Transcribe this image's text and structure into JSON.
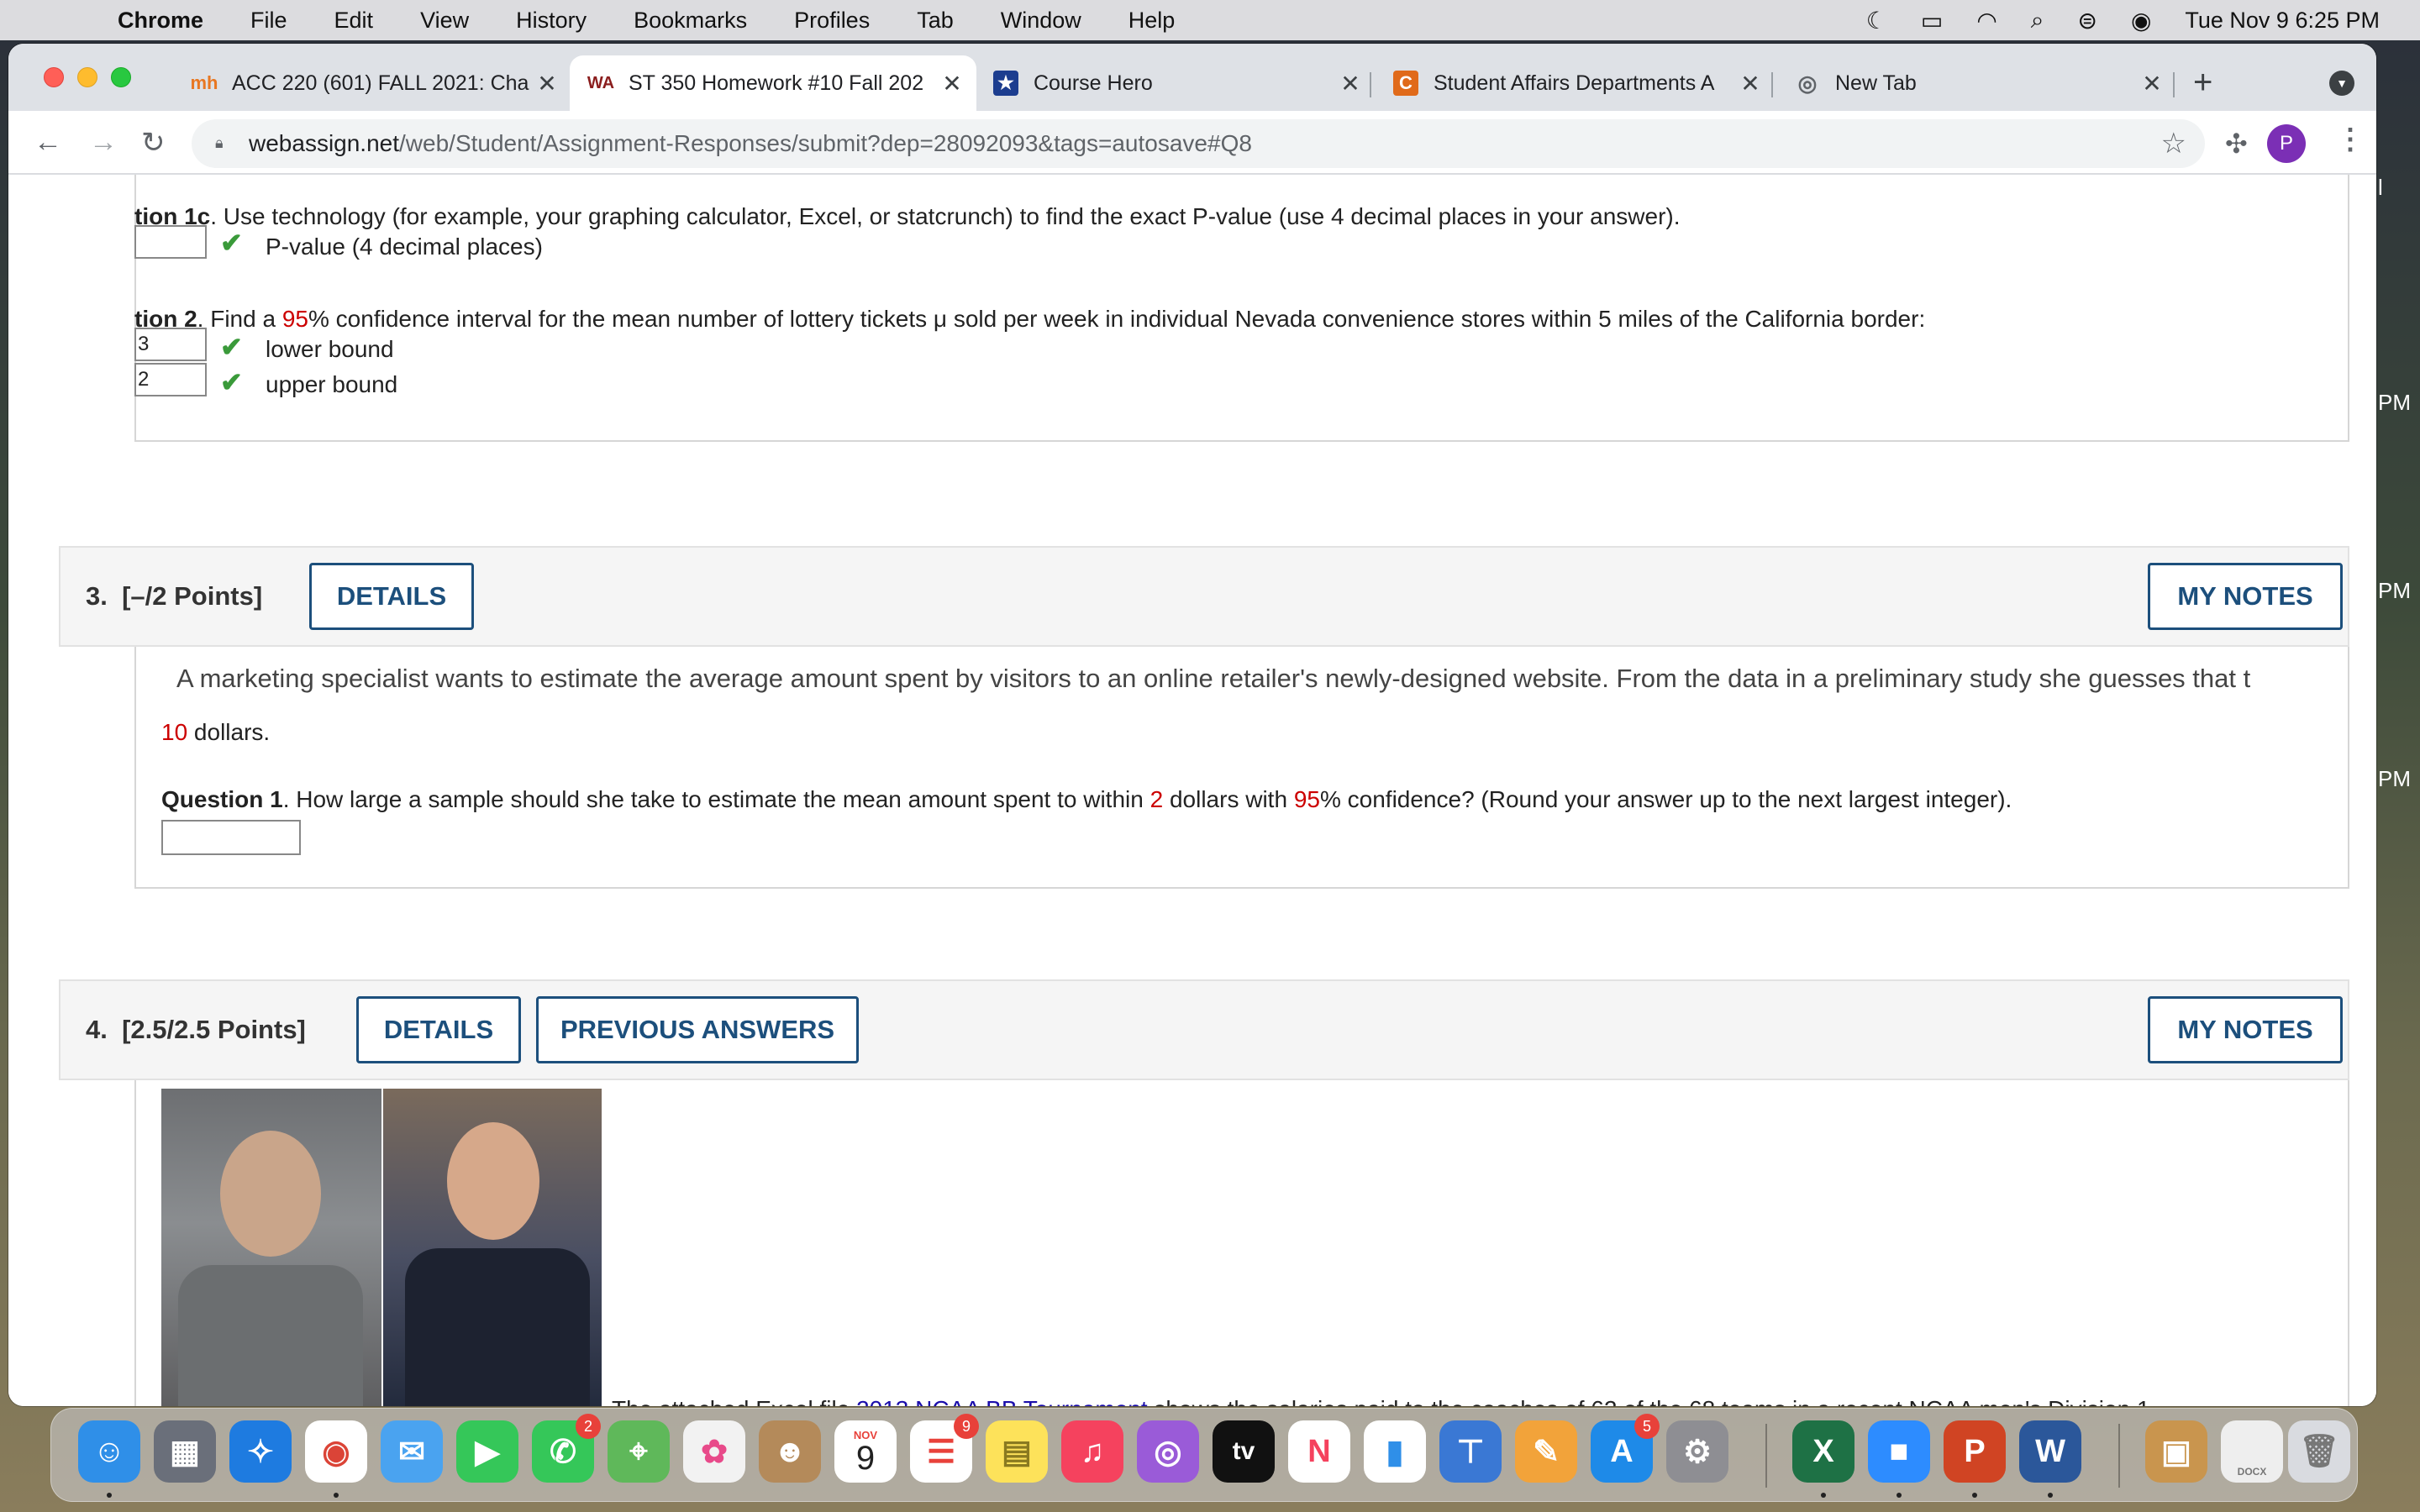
{
  "menubar": {
    "app": "Chrome",
    "items": [
      "File",
      "Edit",
      "View",
      "History",
      "Bookmarks",
      "Profiles",
      "Tab",
      "Window",
      "Help"
    ],
    "clock": "Tue Nov 9  6:25 PM"
  },
  "tabs": [
    {
      "title": "ACC 220 (601) FALL 2021: Cha",
      "favicon": "mh"
    },
    {
      "title": "ST 350 Homework #10 Fall 202",
      "favicon": "WA"
    },
    {
      "title": "Course Hero",
      "favicon": "★"
    },
    {
      "title": "Student Affairs Departments A",
      "favicon": "C"
    },
    {
      "title": "New Tab",
      "favicon": "chrome"
    }
  ],
  "address": {
    "host": "webassign.net",
    "path": "/web/Student/Assignment-Responses/submit?dep=28092093&tags=autosave#Q8"
  },
  "profile_initial": "P",
  "section_top": {
    "q1c_prefix": "tion 1c",
    "q1c_text": ". Use technology (for example, your graphing calculator, Excel, or statcrunch) to find the exact P-value (use 4 decimal places in your answer).",
    "pvalue_label": "P-value (4 decimal places)",
    "q2_prefix": "tion 2",
    "q2_text_a": ". Find a ",
    "q2_conf": "95",
    "q2_text_b": "% confidence interval for the mean number of lottery tickets μ sold per week in individual Nevada convenience stores within 5 miles of the California border:",
    "lower_value": "3",
    "upper_value": "2",
    "lower_label": "lower bound",
    "upper_label": "upper bound"
  },
  "question3": {
    "number": "3.",
    "points": "[–/2 Points]",
    "details_label": "DETAILS",
    "notes_label": "MY NOTES",
    "intro": "A marketing specialist wants to estimate the average amount spent by visitors to an online retailer's newly-designed website. From the data in a preliminary study she guesses that t",
    "intro_value": "10",
    "intro_unit": " dollars.",
    "q_label": "Question 1",
    "q_text_a": ". How large a sample should she take to estimate the mean amount spent to within ",
    "q_margin": "2",
    "q_text_b": " dollars with ",
    "q_conf": "95",
    "q_text_c": "% confidence? (Round your answer up to the next largest integer)."
  },
  "question4": {
    "number": "4.",
    "points": "[2.5/2.5 Points]",
    "details_label": "DETAILS",
    "prev_label": "PREVIOUS ANSWERS",
    "notes_label": "MY NOTES",
    "excel_prefix": "The attached Excel file ",
    "excel_link": "2013 NCAA BB Tournament",
    "excel_suffix": " shows the salaries paid to the coaches of 62 of the 68 teams in a recent NCAA men's Division 1"
  },
  "dock": {
    "calendar_month": "NOV",
    "calendar_day": "9",
    "badges": {
      "messages": "2",
      "reminders": "9",
      "appstore": "5"
    },
    "docx_label": "DOCX"
  },
  "side_labels": [
    "l",
    "PM",
    "PM",
    "PM"
  ]
}
